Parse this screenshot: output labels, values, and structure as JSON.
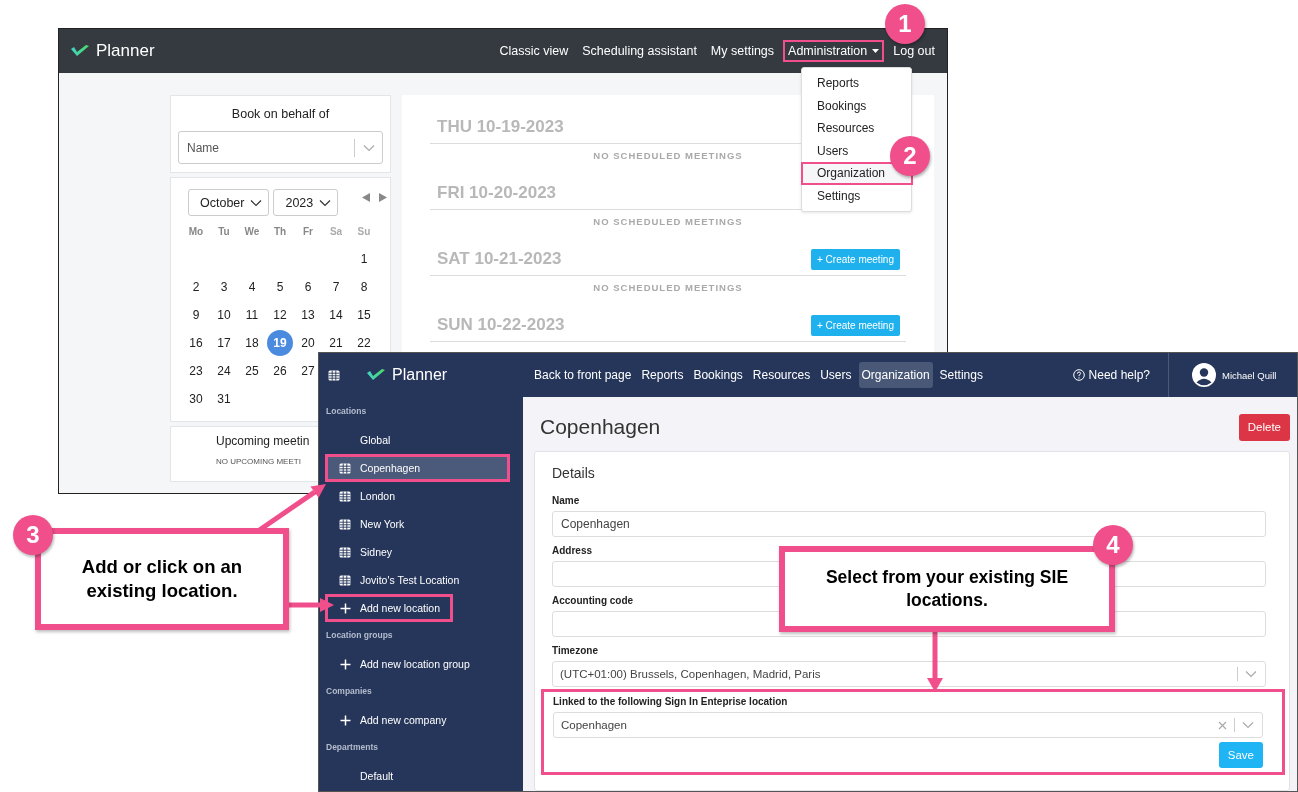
{
  "back_window": {
    "app_name": "Planner",
    "nav": [
      {
        "label": "Classic view",
        "highlighted": false,
        "dropdown": false
      },
      {
        "label": "Scheduling assistant",
        "highlighted": false,
        "dropdown": false
      },
      {
        "label": "My settings",
        "highlighted": false,
        "dropdown": false
      },
      {
        "label": "Administration",
        "highlighted": true,
        "dropdown": true
      },
      {
        "label": "Log out",
        "highlighted": false,
        "dropdown": false
      }
    ],
    "admin_menu": {
      "items": [
        {
          "label": "Reports",
          "highlighted": false
        },
        {
          "label": "Bookings",
          "highlighted": false
        },
        {
          "label": "Resources",
          "highlighted": false
        },
        {
          "label": "Users",
          "highlighted": false
        },
        {
          "label": "Organization",
          "highlighted": true
        },
        {
          "label": "Settings",
          "highlighted": false
        }
      ]
    },
    "book_on_behalf": {
      "title": "Book on behalf of",
      "placeholder": "Name"
    },
    "calendar": {
      "month": "October",
      "year": "2023",
      "weekdays": [
        "Mo",
        "Tu",
        "We",
        "Th",
        "Fr",
        "Sa",
        "Su"
      ],
      "weeks": [
        [
          {
            "label": "1",
            "selected": false
          }
        ],
        [
          {
            "label": "2",
            "selected": false
          },
          {
            "label": "3",
            "selected": false
          },
          {
            "label": "4",
            "selected": false
          },
          {
            "label": "5",
            "selected": false
          },
          {
            "label": "6",
            "selected": false
          },
          {
            "label": "7",
            "selected": false
          },
          {
            "label": "8",
            "selected": false
          }
        ],
        [
          {
            "label": "9",
            "selected": false
          },
          {
            "label": "10",
            "selected": false
          },
          {
            "label": "11",
            "selected": false
          },
          {
            "label": "12",
            "selected": false
          },
          {
            "label": "13",
            "selected": false
          },
          {
            "label": "14",
            "selected": false
          },
          {
            "label": "15",
            "selected": false
          }
        ],
        [
          {
            "label": "16",
            "selected": false
          },
          {
            "label": "17",
            "selected": false
          },
          {
            "label": "18",
            "selected": false
          },
          {
            "label": "19",
            "selected": true
          },
          {
            "label": "20",
            "selected": false
          },
          {
            "label": "21",
            "selected": false
          },
          {
            "label": "22",
            "selected": false
          }
        ],
        [
          {
            "label": "23",
            "selected": false
          },
          {
            "label": "24",
            "selected": false
          },
          {
            "label": "25",
            "selected": false
          },
          {
            "label": "26",
            "selected": false
          },
          {
            "label": "27",
            "selected": false
          }
        ],
        [
          {
            "label": "30",
            "selected": false
          },
          {
            "label": "31",
            "selected": false
          }
        ]
      ]
    },
    "upcoming": {
      "title": "Upcoming meetin",
      "empty_text": "NO UPCOMING MEETI"
    },
    "days": [
      {
        "heading": "THU 10-19-2023",
        "empty_text": "NO SCHEDULED MEETINGS"
      },
      {
        "heading": "FRI 10-20-2023",
        "empty_text": "NO SCHEDULED MEETINGS"
      },
      {
        "heading": "SAT 10-21-2023",
        "empty_text": "NO SCHEDULED MEETINGS",
        "button": "+ Create meeting"
      },
      {
        "heading": "SUN 10-22-2023",
        "button": "+ Create meeting"
      }
    ]
  },
  "front_window": {
    "app_name": "Planner",
    "nav": [
      {
        "label": "Back to front page",
        "selected": false
      },
      {
        "label": "Reports",
        "selected": false
      },
      {
        "label": "Bookings",
        "selected": false
      },
      {
        "label": "Resources",
        "selected": false
      },
      {
        "label": "Users",
        "selected": false
      },
      {
        "label": "Organization",
        "selected": true
      },
      {
        "label": "Settings",
        "selected": false
      }
    ],
    "help": "Need help?",
    "user": "Michael Quill",
    "sidebar": {
      "sections": [
        {
          "title": "Locations",
          "items": [
            {
              "label": "Global",
              "kind": "plain",
              "selected": false,
              "highlighted": false
            },
            {
              "label": "Copenhagen",
              "kind": "location",
              "selected": true,
              "highlighted": true
            },
            {
              "label": "London",
              "kind": "location",
              "selected": false,
              "highlighted": false
            },
            {
              "label": "New York",
              "kind": "location",
              "selected": false,
              "highlighted": false
            },
            {
              "label": "Sidney",
              "kind": "location",
              "selected": false,
              "highlighted": false
            },
            {
              "label": "Jovito's Test Location",
              "kind": "location",
              "selected": false,
              "highlighted": false
            },
            {
              "label": "Add new location",
              "kind": "add",
              "selected": false,
              "highlighted": true
            }
          ]
        },
        {
          "title": "Location groups",
          "items": [
            {
              "label": "Add new location group",
              "kind": "add",
              "selected": false,
              "highlighted": false
            }
          ]
        },
        {
          "title": "Companies",
          "items": [
            {
              "label": "Add new company",
              "kind": "add",
              "selected": false,
              "highlighted": false
            }
          ]
        },
        {
          "title": "Departments",
          "items": [
            {
              "label": "Default",
              "kind": "plain",
              "selected": false,
              "highlighted": false
            }
          ]
        }
      ]
    },
    "title": "Copenhagen",
    "delete_button": "Delete",
    "details": {
      "title": "Details",
      "fields": [
        {
          "label": "Name",
          "kind": "input",
          "value": "Copenhagen"
        },
        {
          "label": "Address",
          "kind": "input"
        },
        {
          "label": "Accounting code",
          "kind": "input"
        },
        {
          "label": "Timezone",
          "kind": "select",
          "value": "(UTC+01:00) Brussels, Copenhagen, Madrid, Paris"
        }
      ],
      "linked_location": {
        "label": "Linked to the following Sign In Enteprise location",
        "value": "Copenhagen",
        "clearable": true,
        "highlighted": true
      },
      "save_button": "Save"
    }
  },
  "annotations": {
    "badges": [
      {
        "number": "1"
      },
      {
        "number": "2"
      }
    ],
    "callouts": [
      {
        "number": "3",
        "text": "Add or click on an existing location."
      },
      {
        "number": "4",
        "text": "Select from your existing SIE locations."
      }
    ]
  }
}
